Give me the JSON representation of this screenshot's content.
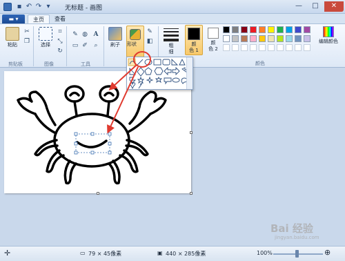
{
  "window": {
    "title": "无标题 - 画图",
    "controls": {
      "minimize": "—",
      "maximize": "□",
      "close": "✕"
    }
  },
  "quick_access": [
    "save-icon",
    "undo-icon",
    "redo-icon",
    "customize-icon"
  ],
  "tabs": [
    {
      "label": "主页",
      "active": true
    },
    {
      "label": "查看",
      "active": false
    }
  ],
  "ribbon": {
    "clipboard": {
      "paste_label": "粘贴",
      "group_label": "剪贴板"
    },
    "image": {
      "select_label": "选择",
      "group_label": "图像"
    },
    "tools": {
      "group_label": "工具",
      "text_tool": "A"
    },
    "brushes_label": "刷子",
    "shapes_label": "形状",
    "size_label": "粗\n细",
    "size_label_top": "粗",
    "size_label_bottom": "细",
    "color1_label": "颜\n色 1",
    "color1_line1": "颜",
    "color1_line2": "色 1",
    "color2_line1": "颜",
    "color2_line2": "色 2",
    "edit_colors_label": "编辑颜色",
    "colors_group_label": "颜色"
  },
  "colors": {
    "accent": "#f7c86a",
    "annotation": "#e03a2f",
    "color1": "#000000",
    "color2": "#ffffff",
    "palette_row1": [
      "#000000",
      "#7f7f7f",
      "#880015",
      "#ed1c24",
      "#ff7f27",
      "#fff200",
      "#22b14c",
      "#00a2e8",
      "#3f48cc",
      "#a349a4"
    ],
    "palette_row2": [
      "#ffffff",
      "#c3c3c3",
      "#b97a57",
      "#ffaec9",
      "#ffc90e",
      "#efe4b0",
      "#b5e61d",
      "#99d9ea",
      "#7092be",
      "#c8bfe7"
    ]
  },
  "status": {
    "selection_size": "79 × 45像素",
    "image_size": "440 × 285像素",
    "zoom": "100%"
  },
  "watermark": {
    "text": "Bai 经验",
    "url": "jingyan.baidu.com"
  }
}
